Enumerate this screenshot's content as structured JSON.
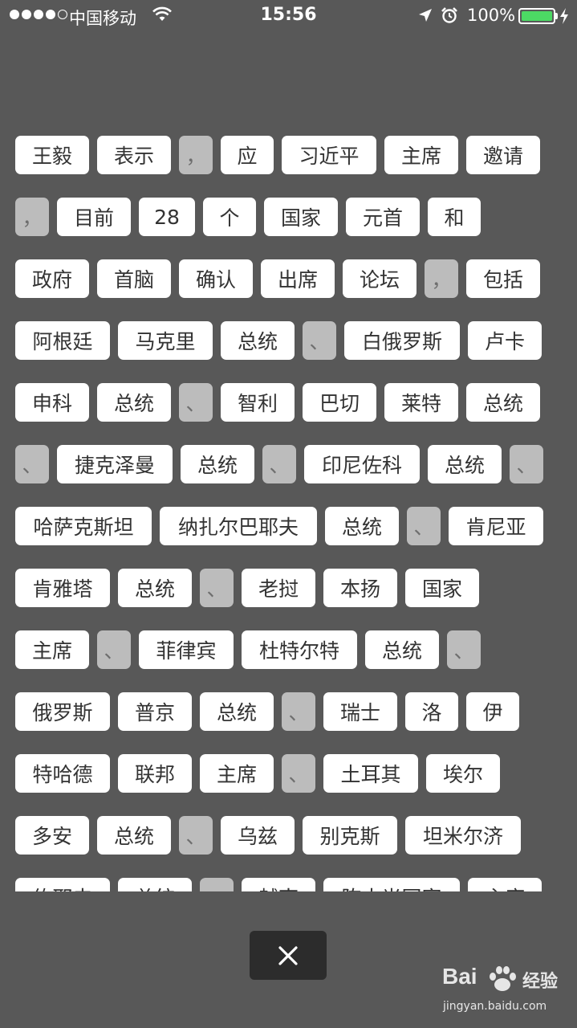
{
  "status_bar": {
    "carrier": "中国移动",
    "time": "15:56",
    "battery_percent": "100%",
    "signal_bars_filled": 4,
    "signal_bars_total": 5,
    "battery_color": "#4cd964"
  },
  "rows": [
    [
      {
        "text": "王毅",
        "punct": false
      },
      {
        "text": "表示",
        "punct": false
      },
      {
        "text": "，",
        "punct": true
      },
      {
        "text": "应",
        "punct": false
      },
      {
        "text": "习近平",
        "punct": false
      },
      {
        "text": "主席",
        "punct": false
      },
      {
        "text": "邀请",
        "punct": false
      }
    ],
    [
      {
        "text": "，",
        "punct": true
      },
      {
        "text": "目前",
        "punct": false
      },
      {
        "text": "28",
        "punct": false
      },
      {
        "text": "个",
        "punct": false
      },
      {
        "text": "国家",
        "punct": false
      },
      {
        "text": "元首",
        "punct": false
      },
      {
        "text": "和",
        "punct": false
      }
    ],
    [
      {
        "text": "政府",
        "punct": false
      },
      {
        "text": "首脑",
        "punct": false
      },
      {
        "text": "确认",
        "punct": false
      },
      {
        "text": "出席",
        "punct": false
      },
      {
        "text": "论坛",
        "punct": false
      },
      {
        "text": "，",
        "punct": true
      },
      {
        "text": "包括",
        "punct": false
      }
    ],
    [
      {
        "text": "阿根廷",
        "punct": false
      },
      {
        "text": "马克里",
        "punct": false
      },
      {
        "text": "总统",
        "punct": false
      },
      {
        "text": "、",
        "punct": true
      },
      {
        "text": "白俄罗斯",
        "punct": false
      },
      {
        "text": "卢卡",
        "punct": false
      }
    ],
    [
      {
        "text": "申科",
        "punct": false
      },
      {
        "text": "总统",
        "punct": false
      },
      {
        "text": "、",
        "punct": true
      },
      {
        "text": "智利",
        "punct": false
      },
      {
        "text": "巴切",
        "punct": false
      },
      {
        "text": "莱特",
        "punct": false
      },
      {
        "text": "总统",
        "punct": false
      }
    ],
    [
      {
        "text": "、",
        "punct": true
      },
      {
        "text": "捷克泽曼",
        "punct": false
      },
      {
        "text": "总统",
        "punct": false
      },
      {
        "text": "、",
        "punct": true
      },
      {
        "text": "印尼佐科",
        "punct": false
      },
      {
        "text": "总统",
        "punct": false
      },
      {
        "text": "、",
        "punct": true
      }
    ],
    [
      {
        "text": "哈萨克斯坦",
        "punct": false
      },
      {
        "text": "纳扎尔巴耶夫",
        "punct": false
      },
      {
        "text": "总统",
        "punct": false
      },
      {
        "text": "、",
        "punct": true
      },
      {
        "text": "肯尼亚",
        "punct": false
      }
    ],
    [
      {
        "text": "肯雅塔",
        "punct": false
      },
      {
        "text": "总统",
        "punct": false
      },
      {
        "text": "、",
        "punct": true
      },
      {
        "text": "老挝",
        "punct": false
      },
      {
        "text": "本扬",
        "punct": false
      },
      {
        "text": "国家",
        "punct": false
      }
    ],
    [
      {
        "text": "主席",
        "punct": false
      },
      {
        "text": "、",
        "punct": true
      },
      {
        "text": "菲律宾",
        "punct": false
      },
      {
        "text": "杜特尔特",
        "punct": false
      },
      {
        "text": "总统",
        "punct": false
      },
      {
        "text": "、",
        "punct": true
      }
    ],
    [
      {
        "text": "俄罗斯",
        "punct": false
      },
      {
        "text": "普京",
        "punct": false
      },
      {
        "text": "总统",
        "punct": false
      },
      {
        "text": "、",
        "punct": true
      },
      {
        "text": "瑞士",
        "punct": false
      },
      {
        "text": "洛",
        "punct": false
      },
      {
        "text": "伊",
        "punct": false
      }
    ],
    [
      {
        "text": "特哈德",
        "punct": false
      },
      {
        "text": "联邦",
        "punct": false
      },
      {
        "text": "主席",
        "punct": false
      },
      {
        "text": "、",
        "punct": true
      },
      {
        "text": "土耳其",
        "punct": false
      },
      {
        "text": "埃尔",
        "punct": false
      }
    ],
    [
      {
        "text": "多安",
        "punct": false
      },
      {
        "text": "总统",
        "punct": false
      },
      {
        "text": "、",
        "punct": true
      },
      {
        "text": "乌兹",
        "punct": false
      },
      {
        "text": "别克斯",
        "punct": false
      },
      {
        "text": "坦米尔济",
        "punct": false
      }
    ],
    [
      {
        "text": "约耶夫",
        "punct": false
      },
      {
        "text": "总统",
        "punct": false
      },
      {
        "text": "、",
        "punct": true
      },
      {
        "text": "越南",
        "punct": false
      },
      {
        "text": "陈大光国家",
        "punct": false
      },
      {
        "text": "主席",
        "punct": false
      }
    ]
  ],
  "close_button": {
    "icon": "close-icon"
  },
  "watermark": {
    "logo_text": "Bai",
    "logo_paw": "paw-icon",
    "name": "经验",
    "url": "jingyan.baidu.com"
  }
}
